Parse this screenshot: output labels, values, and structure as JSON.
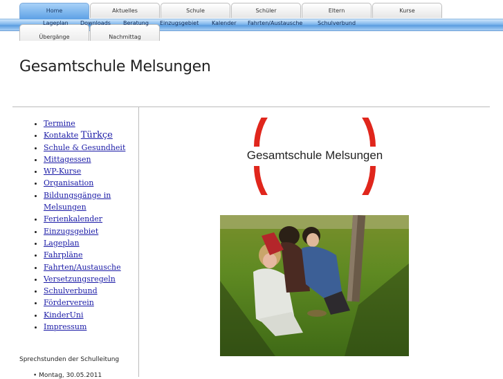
{
  "tabs": [
    {
      "label": "Home",
      "active": true
    },
    {
      "label": "Aktuelles"
    },
    {
      "label": "Schule"
    },
    {
      "label": "Schüler"
    },
    {
      "label": "Eltern"
    },
    {
      "label": "Kurse"
    }
  ],
  "tabs_row2": [
    {
      "label": "Übergänge"
    },
    {
      "label": "Nachmittag"
    }
  ],
  "subnav": [
    "Lageplan",
    "Downloads",
    "Beratung",
    "Einzugsgebiet",
    "Kalender",
    "Fahrten/Austausche",
    "Schulverbund"
  ],
  "page_title": "Gesamtschule Melsungen",
  "sidebar": {
    "items": [
      {
        "label": "Termine"
      },
      {
        "label": "Kontakte",
        "extra": "Türkçe"
      },
      {
        "label": "Schule & Gesundheit"
      },
      {
        "label": "Mittagessen"
      },
      {
        "label": "WP-Kurse"
      },
      {
        "label": "Organisation"
      },
      {
        "label": "Bildungsgänge in Melsungen"
      },
      {
        "label": "Ferienkalender"
      },
      {
        "label": "Einzugsgebiet"
      },
      {
        "label": "Lageplan"
      },
      {
        "label": "Fahrpläne"
      },
      {
        "label": "Fahrten/Austausche"
      },
      {
        "label": "Versetzungsregeln"
      },
      {
        "label": "Schulverbund"
      },
      {
        "label": "Förderverein"
      },
      {
        "label": "KinderUni"
      },
      {
        "label": "Impressum"
      }
    ],
    "sprechstunden": "Sprechstunden der Schulleitung",
    "first_date": "• Montag, 30.05.2011"
  },
  "logo": {
    "text": "Gesamtschule Melsungen",
    "ring_color": "#e0261c"
  },
  "photo_alt": "Schüler im Freien",
  "colors": {
    "tab_active": "#5da1e5",
    "link": "#1a1aa6"
  }
}
